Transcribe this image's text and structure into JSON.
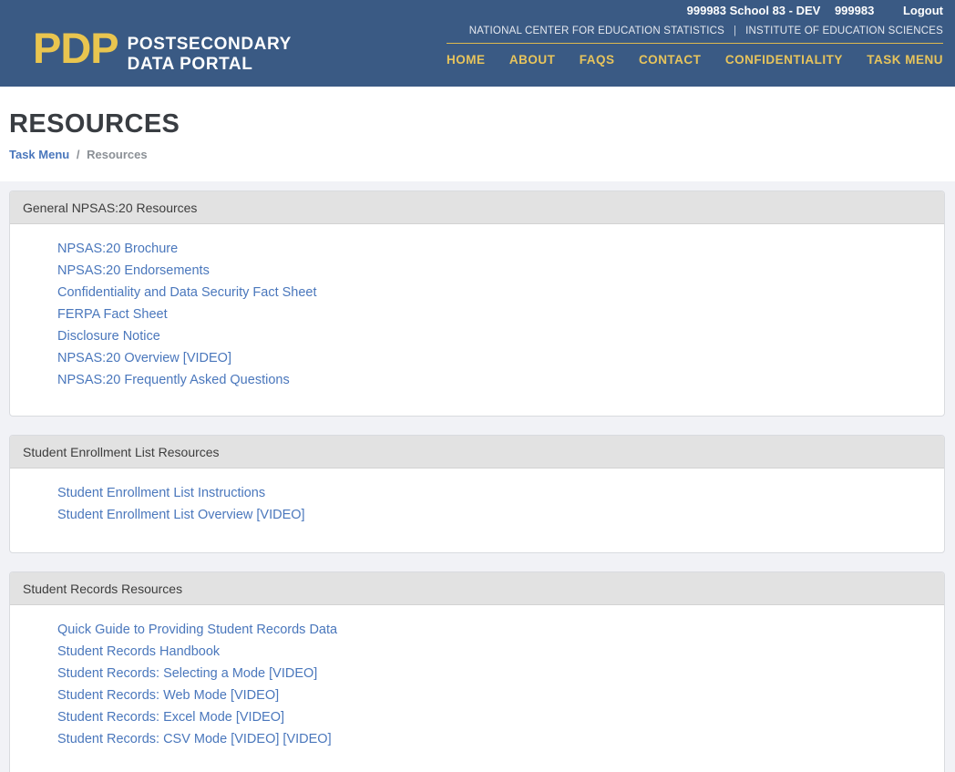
{
  "topbar": {
    "school_label": "999983 School 83 - DEV",
    "school_id": "999983",
    "logout_label": "Logout"
  },
  "header": {
    "logo_acronym": "PDP",
    "logo_line1": "POSTSECONDARY",
    "logo_line2": "DATA PORTAL",
    "agency_left": "NATIONAL CENTER FOR EDUCATION STATISTICS",
    "agency_separator": "|",
    "agency_right": "INSTITUTE OF EDUCATION SCIENCES",
    "nav": [
      "HOME",
      "ABOUT",
      "FAQS",
      "CONTACT",
      "CONFIDENTIALITY",
      "TASK MENU"
    ]
  },
  "page": {
    "title": "RESOURCES",
    "breadcrumb": {
      "link": "Task Menu",
      "separator": "/",
      "current": "Resources"
    }
  },
  "sections": [
    {
      "title": "General NPSAS:20 Resources",
      "links": [
        "NPSAS:20 Brochure",
        "NPSAS:20 Endorsements",
        "Confidentiality and Data Security Fact Sheet",
        "FERPA Fact Sheet",
        "Disclosure Notice",
        "NPSAS:20 Overview [VIDEO]",
        "NPSAS:20 Frequently Asked Questions"
      ]
    },
    {
      "title": "Student Enrollment List Resources",
      "links": [
        "Student Enrollment List Instructions",
        "Student Enrollment List Overview [VIDEO]"
      ]
    },
    {
      "title": "Student Records Resources",
      "links": [
        "Quick Guide to Providing Student Records Data",
        "Student Records Handbook",
        "Student Records: Selecting a Mode [VIDEO]",
        "Student Records: Web Mode [VIDEO]",
        "Student Records: Excel Mode [VIDEO]",
        "Student Records: CSV Mode [VIDEO] [VIDEO]"
      ]
    }
  ],
  "colors": {
    "header_blue": "#3a5a84",
    "gold_accent": "#e9c54f",
    "nav_gold": "#e7c45c",
    "link_blue": "#4a77bc",
    "title_dark": "#393d42",
    "breadcrumb_gray": "#8b9096",
    "panel_header_bg": "#e2e2e2",
    "content_bg": "#f1f2f6"
  }
}
